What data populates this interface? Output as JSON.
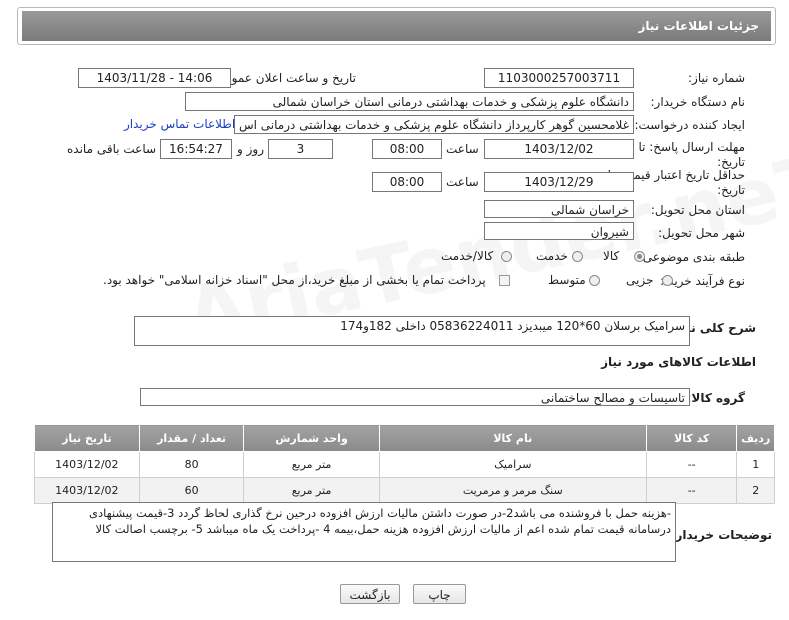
{
  "header": {
    "title": "جزئیات اطلاعات نیاز"
  },
  "watermark": "AriaTender.neT",
  "fields": {
    "need_number": {
      "label": "شماره نیاز:",
      "value": "1103000257003711"
    },
    "announce_datetime": {
      "label": "تاریخ و ساعت اعلان عمومی:",
      "value": "1403/11/28 - 14:06"
    },
    "buyer_org": {
      "label": "نام دستگاه خریدار:",
      "value": "دانشگاه علوم پزشکی و خدمات بهداشتی درمانی استان خراسان شمالی"
    },
    "requester": {
      "label": "ایجاد کننده درخواست:",
      "value": "غلامحسین گوهر کارپرداز  دانشگاه علوم پزشکی و خدمات بهداشتی درمانی اس",
      "contact_link": "اطلاعات تماس خریدار"
    },
    "send_deadline": {
      "label1": "مهلت ارسال پاسخ: تا",
      "label2": "تاریخ:",
      "date": "1403/12/02",
      "time_label": "ساعت",
      "time": "08:00",
      "days": "3",
      "days_label": "روز و",
      "remaining_time": "16:54:27",
      "remaining_label": "ساعت باقی مانده"
    },
    "price_validity": {
      "label1": "حداقل تاریخ اعتبار قیمت: تا",
      "label2": "تاریخ:",
      "date": "1403/12/29",
      "time_label": "ساعت",
      "time": "08:00"
    },
    "delivery_province": {
      "label": "استان محل تحویل:",
      "value": "خراسان شمالی"
    },
    "delivery_city": {
      "label": "شهر محل تحویل:",
      "value": "شیروان"
    },
    "category": {
      "label": "طبقه بندی موضوعی:",
      "options": [
        "کالا",
        "خدمت",
        "کالا/خدمت"
      ],
      "selected": "کالا"
    },
    "purchase_type": {
      "label": "نوع فرآیند خرید :",
      "options": [
        "جزیی",
        "متوسط"
      ],
      "selected": "",
      "payment_note": "پرداخت تمام یا بخشی از مبلغ خرید،از محل \"اسناد خزانه اسلامی\" خواهد بود."
    },
    "description": {
      "label": "شرح کلی نیاز:",
      "value": "سرامیک برسلان 60*120 میبدیزد 05836224011 داخلی 182و174"
    }
  },
  "goods_info": {
    "title": "اطلاعات کالاهای مورد نیاز",
    "group_label": "گروه کالا:",
    "group_value": "تاسیسات و مصالح ساختمانی",
    "columns": [
      "ردیف",
      "کد کالا",
      "نام کالا",
      "واحد شمارش",
      "تعداد / مقدار",
      "تاریخ نیاز"
    ],
    "rows": [
      {
        "row": "1",
        "code": "--",
        "name": "سرامیک",
        "unit": "متر مربع",
        "qty": "80",
        "date": "1403/12/02"
      },
      {
        "row": "2",
        "code": "--",
        "name": "سنگ مرمر و مرمریت",
        "unit": "متر مربع",
        "qty": "60",
        "date": "1403/12/02"
      }
    ]
  },
  "buyer_notes": {
    "label": "توضیحات خریدار:",
    "text": "-هزینه حمل با فروشنده می باشد2-در صورت داشتن مالیات ارزش افزوده درحین نرخ گذاری لحاظ گردد 3-قیمت پیشنهادی درسامانه  قیمت تمام شده اعم از مالیات ارزش افزوده هزینه حمل،بیمه  4 -پرداخت یک ماه میباشد 5- برچسب اصالت کالا"
  },
  "buttons": {
    "print": "چاپ",
    "back": "بازگشت"
  }
}
